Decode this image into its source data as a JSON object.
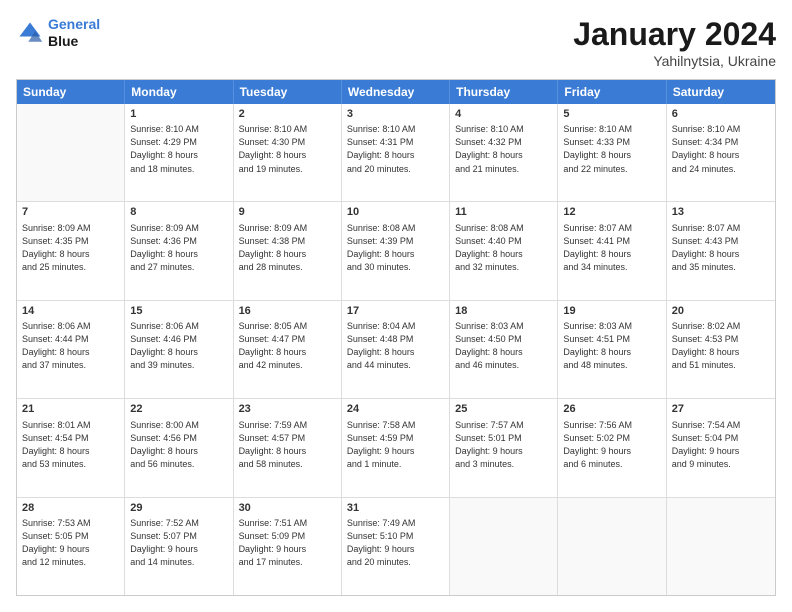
{
  "header": {
    "logo_line1": "General",
    "logo_line2": "Blue",
    "title": "January 2024",
    "subtitle": "Yahilnytsia, Ukraine"
  },
  "weekdays": [
    "Sunday",
    "Monday",
    "Tuesday",
    "Wednesday",
    "Thursday",
    "Friday",
    "Saturday"
  ],
  "rows": [
    [
      {
        "day": null,
        "info": null
      },
      {
        "day": "1",
        "info": "Sunrise: 8:10 AM\nSunset: 4:29 PM\nDaylight: 8 hours\nand 18 minutes."
      },
      {
        "day": "2",
        "info": "Sunrise: 8:10 AM\nSunset: 4:30 PM\nDaylight: 8 hours\nand 19 minutes."
      },
      {
        "day": "3",
        "info": "Sunrise: 8:10 AM\nSunset: 4:31 PM\nDaylight: 8 hours\nand 20 minutes."
      },
      {
        "day": "4",
        "info": "Sunrise: 8:10 AM\nSunset: 4:32 PM\nDaylight: 8 hours\nand 21 minutes."
      },
      {
        "day": "5",
        "info": "Sunrise: 8:10 AM\nSunset: 4:33 PM\nDaylight: 8 hours\nand 22 minutes."
      },
      {
        "day": "6",
        "info": "Sunrise: 8:10 AM\nSunset: 4:34 PM\nDaylight: 8 hours\nand 24 minutes."
      }
    ],
    [
      {
        "day": "7",
        "info": "Sunrise: 8:09 AM\nSunset: 4:35 PM\nDaylight: 8 hours\nand 25 minutes."
      },
      {
        "day": "8",
        "info": "Sunrise: 8:09 AM\nSunset: 4:36 PM\nDaylight: 8 hours\nand 27 minutes."
      },
      {
        "day": "9",
        "info": "Sunrise: 8:09 AM\nSunset: 4:38 PM\nDaylight: 8 hours\nand 28 minutes."
      },
      {
        "day": "10",
        "info": "Sunrise: 8:08 AM\nSunset: 4:39 PM\nDaylight: 8 hours\nand 30 minutes."
      },
      {
        "day": "11",
        "info": "Sunrise: 8:08 AM\nSunset: 4:40 PM\nDaylight: 8 hours\nand 32 minutes."
      },
      {
        "day": "12",
        "info": "Sunrise: 8:07 AM\nSunset: 4:41 PM\nDaylight: 8 hours\nand 34 minutes."
      },
      {
        "day": "13",
        "info": "Sunrise: 8:07 AM\nSunset: 4:43 PM\nDaylight: 8 hours\nand 35 minutes."
      }
    ],
    [
      {
        "day": "14",
        "info": "Sunrise: 8:06 AM\nSunset: 4:44 PM\nDaylight: 8 hours\nand 37 minutes."
      },
      {
        "day": "15",
        "info": "Sunrise: 8:06 AM\nSunset: 4:46 PM\nDaylight: 8 hours\nand 39 minutes."
      },
      {
        "day": "16",
        "info": "Sunrise: 8:05 AM\nSunset: 4:47 PM\nDaylight: 8 hours\nand 42 minutes."
      },
      {
        "day": "17",
        "info": "Sunrise: 8:04 AM\nSunset: 4:48 PM\nDaylight: 8 hours\nand 44 minutes."
      },
      {
        "day": "18",
        "info": "Sunrise: 8:03 AM\nSunset: 4:50 PM\nDaylight: 8 hours\nand 46 minutes."
      },
      {
        "day": "19",
        "info": "Sunrise: 8:03 AM\nSunset: 4:51 PM\nDaylight: 8 hours\nand 48 minutes."
      },
      {
        "day": "20",
        "info": "Sunrise: 8:02 AM\nSunset: 4:53 PM\nDaylight: 8 hours\nand 51 minutes."
      }
    ],
    [
      {
        "day": "21",
        "info": "Sunrise: 8:01 AM\nSunset: 4:54 PM\nDaylight: 8 hours\nand 53 minutes."
      },
      {
        "day": "22",
        "info": "Sunrise: 8:00 AM\nSunset: 4:56 PM\nDaylight: 8 hours\nand 56 minutes."
      },
      {
        "day": "23",
        "info": "Sunrise: 7:59 AM\nSunset: 4:57 PM\nDaylight: 8 hours\nand 58 minutes."
      },
      {
        "day": "24",
        "info": "Sunrise: 7:58 AM\nSunset: 4:59 PM\nDaylight: 9 hours\nand 1 minute."
      },
      {
        "day": "25",
        "info": "Sunrise: 7:57 AM\nSunset: 5:01 PM\nDaylight: 9 hours\nand 3 minutes."
      },
      {
        "day": "26",
        "info": "Sunrise: 7:56 AM\nSunset: 5:02 PM\nDaylight: 9 hours\nand 6 minutes."
      },
      {
        "day": "27",
        "info": "Sunrise: 7:54 AM\nSunset: 5:04 PM\nDaylight: 9 hours\nand 9 minutes."
      }
    ],
    [
      {
        "day": "28",
        "info": "Sunrise: 7:53 AM\nSunset: 5:05 PM\nDaylight: 9 hours\nand 12 minutes."
      },
      {
        "day": "29",
        "info": "Sunrise: 7:52 AM\nSunset: 5:07 PM\nDaylight: 9 hours\nand 14 minutes."
      },
      {
        "day": "30",
        "info": "Sunrise: 7:51 AM\nSunset: 5:09 PM\nDaylight: 9 hours\nand 17 minutes."
      },
      {
        "day": "31",
        "info": "Sunrise: 7:49 AM\nSunset: 5:10 PM\nDaylight: 9 hours\nand 20 minutes."
      },
      {
        "day": null,
        "info": null
      },
      {
        "day": null,
        "info": null
      },
      {
        "day": null,
        "info": null
      }
    ]
  ]
}
